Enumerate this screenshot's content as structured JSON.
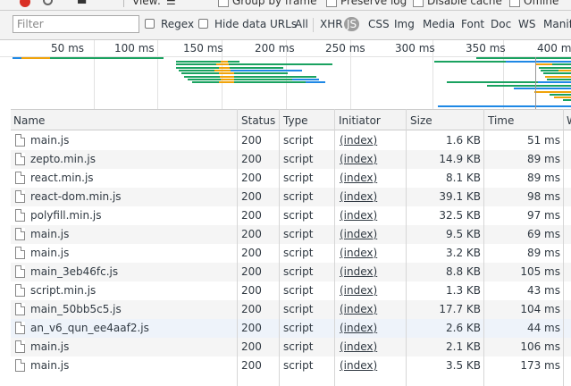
{
  "toolbar": {
    "view_label": "View:",
    "group_by_frame": "Group by frame",
    "preserve_log": "Preserve log",
    "disable_cache": "Disable cache",
    "offline": "Offline"
  },
  "filter": {
    "placeholder": "Filter",
    "regex": "Regex",
    "hide_data_urls": "Hide data URLs",
    "types": [
      "All",
      "XHR",
      "JS",
      "CSS",
      "Img",
      "Media",
      "Font",
      "Doc",
      "WS",
      "Manifest"
    ],
    "active_type": "JS"
  },
  "overview": {
    "ticks": [
      "50 ms",
      "100 ms",
      "150 ms",
      "200 ms",
      "250 ms",
      "300 ms",
      "350 ms",
      "400 ms"
    ],
    "colors": {
      "green": "#1aa260",
      "orange": "#f0a30a",
      "blue": "#1e88e5"
    }
  },
  "table": {
    "columns": [
      "Name",
      "Status",
      "Type",
      "Initiator",
      "Size",
      "Time",
      "W"
    ],
    "rows": [
      {
        "name": "main.js",
        "status": "200",
        "type": "script",
        "initiator": "(index)",
        "size": "1.6 KB",
        "time": "51 ms"
      },
      {
        "name": "zepto.min.js",
        "status": "200",
        "type": "script",
        "initiator": "(index)",
        "size": "14.9 KB",
        "time": "89 ms"
      },
      {
        "name": "react.min.js",
        "status": "200",
        "type": "script",
        "initiator": "(index)",
        "size": "8.1 KB",
        "time": "89 ms"
      },
      {
        "name": "react-dom.min.js",
        "status": "200",
        "type": "script",
        "initiator": "(index)",
        "size": "39.1 KB",
        "time": "98 ms"
      },
      {
        "name": "polyfill.min.js",
        "status": "200",
        "type": "script",
        "initiator": "(index)",
        "size": "32.5 KB",
        "time": "97 ms"
      },
      {
        "name": "main.js",
        "status": "200",
        "type": "script",
        "initiator": "(index)",
        "size": "9.5 KB",
        "time": "69 ms"
      },
      {
        "name": "main.js",
        "status": "200",
        "type": "script",
        "initiator": "(index)",
        "size": "3.2 KB",
        "time": "89 ms"
      },
      {
        "name": "main_3eb46fc.js",
        "status": "200",
        "type": "script",
        "initiator": "(index)",
        "size": "8.8 KB",
        "time": "105 ms"
      },
      {
        "name": "script.min.js",
        "status": "200",
        "type": "script",
        "initiator": "(index)",
        "size": "1.3 KB",
        "time": "43 ms"
      },
      {
        "name": "main_50bb5c5.js",
        "status": "200",
        "type": "script",
        "initiator": "(index)",
        "size": "17.7 KB",
        "time": "104 ms"
      },
      {
        "name": "an_v6_qun_ee4aaf2.js",
        "status": "200",
        "type": "script",
        "initiator": "(index)",
        "size": "2.6 KB",
        "time": "44 ms"
      },
      {
        "name": "main.js",
        "status": "200",
        "type": "script",
        "initiator": "(index)",
        "size": "2.1 KB",
        "time": "106 ms"
      },
      {
        "name": "main.js",
        "status": "200",
        "type": "script",
        "initiator": "(index)",
        "size": "3.5 KB",
        "time": "173 ms"
      }
    ]
  }
}
